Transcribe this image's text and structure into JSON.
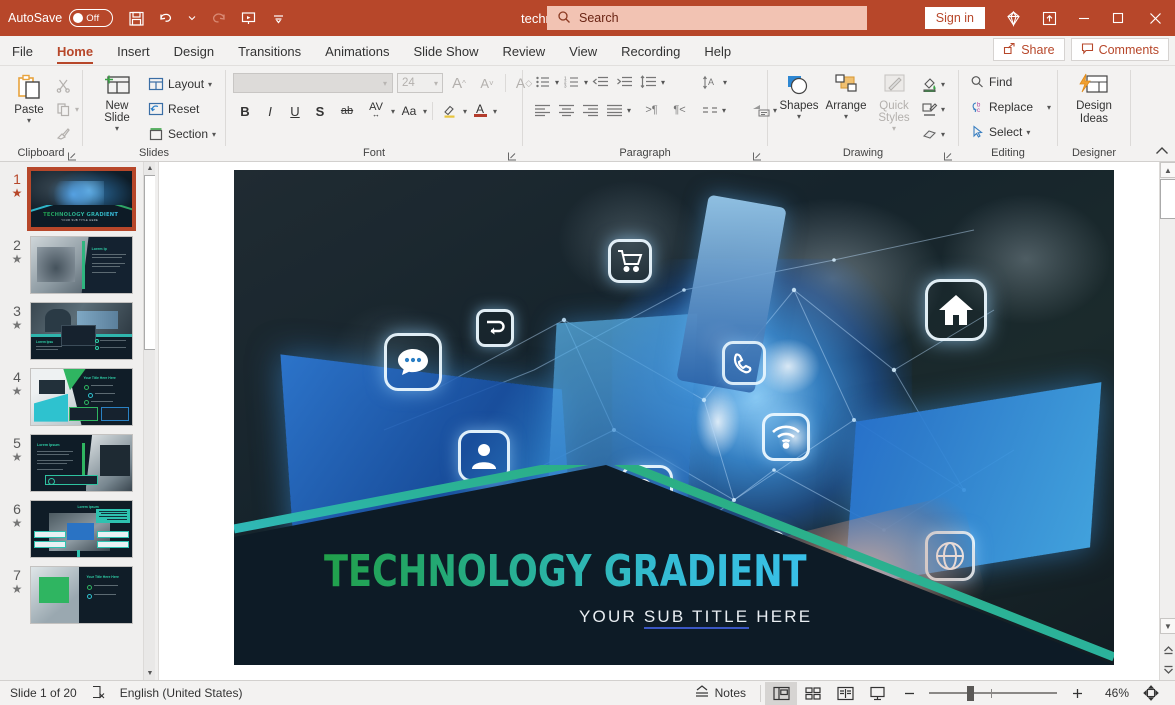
{
  "titlebar": {
    "autosave_label": "AutoSave",
    "autosave_state": "Off",
    "save_icon": "save-icon",
    "undo_icon": "undo-icon",
    "redo_icon": "redo-icon",
    "present_icon": "start-presentation-icon",
    "customize_icon": "customize-quick-access-toolbar-icon",
    "document_title": "technology_gradie...",
    "title_dropdown_icon": "chevron-down-icon",
    "search_placeholder": "Search",
    "search_icon": "search-icon",
    "signin_label": "Sign in",
    "accessibility_icon": "diamond-icon",
    "ribbon_display_icon": "ribbon-display-options-icon",
    "minimize_icon": "minimize-icon",
    "maximize_icon": "maximize-icon",
    "close_icon": "close-icon"
  },
  "tabs": [
    {
      "label": "File",
      "active": false
    },
    {
      "label": "Home",
      "active": true
    },
    {
      "label": "Insert",
      "active": false
    },
    {
      "label": "Design",
      "active": false
    },
    {
      "label": "Transitions",
      "active": false
    },
    {
      "label": "Animations",
      "active": false
    },
    {
      "label": "Slide Show",
      "active": false
    },
    {
      "label": "Review",
      "active": false
    },
    {
      "label": "View",
      "active": false
    },
    {
      "label": "Recording",
      "active": false
    },
    {
      "label": "Help",
      "active": false
    }
  ],
  "tabs_right": {
    "share_label": "Share",
    "share_icon": "share-icon",
    "comments_label": "Comments",
    "comments_icon": "comment-icon"
  },
  "ribbon": {
    "clipboard": {
      "group_label": "Clipboard",
      "paste_label": "Paste",
      "paste_icon": "paste-icon",
      "cut_icon": "scissors-icon",
      "copy_icon": "copy-icon",
      "format_painter_icon": "format-painter-icon",
      "dialog_launcher_icon": "dialog-launcher-icon"
    },
    "slides": {
      "group_label": "Slides",
      "new_slide_label": "New Slide",
      "new_slide_icon": "new-slide-icon",
      "layout_label": "Layout",
      "layout_icon": "layout-icon",
      "reset_label": "Reset",
      "reset_icon": "reset-icon",
      "section_label": "Section",
      "section_icon": "section-icon"
    },
    "font": {
      "group_label": "Font",
      "font_name_value": "",
      "font_size_value": "24",
      "grow_font_icon": "grow-font-icon",
      "shrink_font_icon": "shrink-font-icon",
      "clear_formatting_icon": "clear-formatting-icon",
      "bold_label": "B",
      "italic_label": "I",
      "underline_label": "U",
      "shadow_label": "S",
      "strikethrough_label": "ab",
      "character_spacing_label": "AV",
      "change_case_label": "Aa",
      "text_highlight_icon": "text-highlight-color-icon",
      "font_color_label": "A",
      "dialog_launcher_icon": "dialog-launcher-icon"
    },
    "paragraph": {
      "group_label": "Paragraph",
      "bullets_icon": "bullets-icon",
      "numbering_icon": "numbering-icon",
      "decrease_indent_icon": "decrease-indent-icon",
      "increase_indent_icon": "increase-indent-icon",
      "line_spacing_icon": "line-spacing-icon",
      "text_direction_icon": "text-direction-icon",
      "align_text_icon": "align-text-icon",
      "convert_smartart_icon": "convert-to-smartart-icon",
      "align_left_icon": "align-left-icon",
      "align_center_icon": "align-center-icon",
      "align_right_icon": "align-right-icon",
      "justify_icon": "justify-icon",
      "columns_icon": "columns-icon",
      "ltr_icon": "left-to-right-icon",
      "rtl_icon": "right-to-left-icon",
      "dialog_launcher_icon": "dialog-launcher-icon"
    },
    "drawing": {
      "group_label": "Drawing",
      "shapes_label": "Shapes",
      "shapes_icon": "shapes-icon",
      "arrange_label": "Arrange",
      "arrange_icon": "arrange-icon",
      "quick_styles_label": "Quick Styles",
      "quick_styles_icon": "quick-styles-icon",
      "shape_fill_icon": "shape-fill-icon",
      "shape_outline_icon": "shape-outline-icon",
      "shape_effects_icon": "shape-effects-icon",
      "dialog_launcher_icon": "dialog-launcher-icon"
    },
    "editing": {
      "group_label": "Editing",
      "find_label": "Find",
      "find_icon": "search-icon",
      "replace_label": "Replace",
      "replace_icon": "replace-icon",
      "select_label": "Select",
      "select_icon": "cursor-icon"
    },
    "designer": {
      "group_label": "Designer",
      "design_ideas_label": "Design Ideas",
      "design_ideas_icon": "design-ideas-icon",
      "collapse_ribbon_icon": "chevron-up-icon"
    }
  },
  "thumbnails": [
    {
      "number": "1",
      "star": "★",
      "selected": true
    },
    {
      "number": "2",
      "star": "★",
      "selected": false
    },
    {
      "number": "3",
      "star": "★",
      "selected": false
    },
    {
      "number": "4",
      "star": "★",
      "selected": false
    },
    {
      "number": "5",
      "star": "★",
      "selected": false
    },
    {
      "number": "6",
      "star": "★",
      "selected": false
    },
    {
      "number": "7",
      "star": "★",
      "selected": false
    }
  ],
  "slide": {
    "title": "TECHNOLOGY GRADIENT",
    "subtitle_before": "YOUR ",
    "subtitle_spell": "SUB TITLE",
    "subtitle_after": " HERE",
    "title_gradient_start": "#21a04a",
    "title_gradient_end": "#39c0e8",
    "background_color": "#0d1b26",
    "accent_color": "#3bbfd6"
  },
  "status": {
    "slide_counter": "Slide 1 of 20",
    "accessibility_icon": "accessibility-checker-icon",
    "language": "English (United States)",
    "notes_label": "Notes",
    "notes_icon": "notes-icon",
    "view_normal_icon": "normal-view-icon",
    "view_sorter_icon": "slide-sorter-icon",
    "view_reading_icon": "reading-view-icon",
    "view_slideshow_icon": "slide-show-icon",
    "zoom_out_icon": "zoom-out-icon",
    "zoom_in_icon": "zoom-in-icon",
    "zoom_level": "46%",
    "fit_slide_icon": "fit-slide-to-window-icon"
  }
}
